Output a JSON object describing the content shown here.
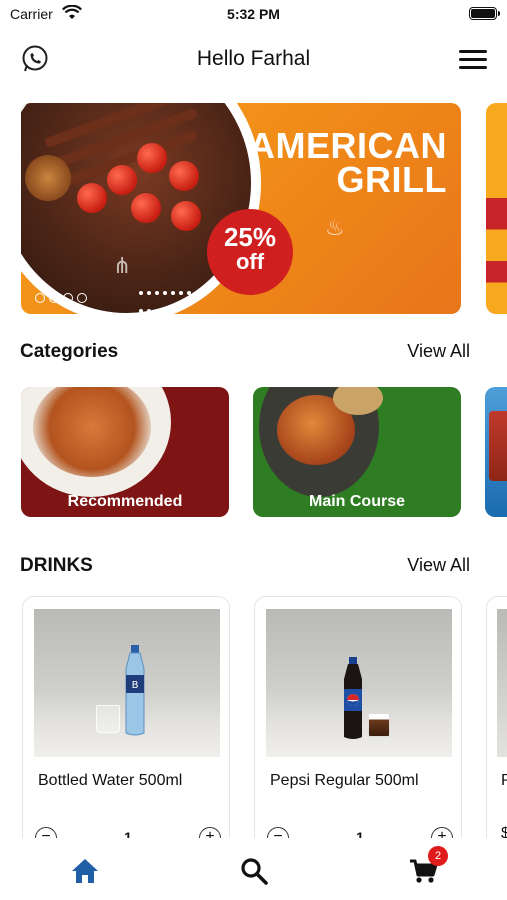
{
  "status_bar": {
    "carrier": "Carrier",
    "time": "5:32 PM"
  },
  "header": {
    "title": "Hello Farhal"
  },
  "banner": {
    "headline_line1": "AMERICAN",
    "headline_line2": "GRILL",
    "promo_percent": "25%",
    "promo_label": "off"
  },
  "categories_section": {
    "heading": "Categories",
    "view_all": "View All",
    "items": [
      {
        "label": "Recommended"
      },
      {
        "label": "Main Course"
      }
    ]
  },
  "drinks_section": {
    "heading": "DRINKS",
    "view_all": "View All",
    "items": [
      {
        "name": "Bottled Water 500ml",
        "quantity": "1",
        "minus": "−",
        "plus": "+"
      },
      {
        "name": "Pepsi Regular 500ml",
        "quantity": "1",
        "minus": "−",
        "plus": "+"
      }
    ],
    "peek_name_char": "P",
    "peek_price_char": "$"
  },
  "bottom_nav": {
    "items": [
      "home-icon",
      "search-icon",
      "cart-icon"
    ],
    "cart_badge": "2",
    "active_color": "#1f5fa6"
  },
  "colors": {
    "banner_orange": "#f08a18",
    "promo_red": "#d01f1f",
    "recommended_bg": "#7e1414",
    "main_course_bg": "#2f7d22"
  }
}
